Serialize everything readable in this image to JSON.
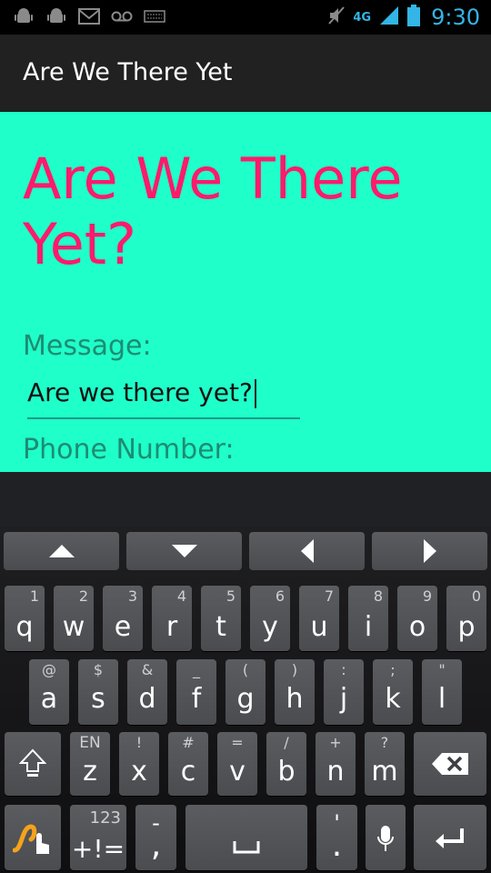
{
  "status_bar": {
    "time": "9:30",
    "network": "4G",
    "icons": [
      "android-debug-icon",
      "android-debug-icon",
      "gmail-icon",
      "voicemail-icon",
      "keyboard-icon",
      "mute-icon",
      "signal-icon",
      "battery-icon"
    ]
  },
  "action_bar": {
    "title": "Are We There Yet"
  },
  "main": {
    "heading": "Are We There Yet?",
    "message_label": "Message:",
    "message_value": "Are we there yet?",
    "phone_label": "Phone Number:"
  },
  "keyboard": {
    "row1": [
      {
        "key": "q",
        "hint": "1"
      },
      {
        "key": "w",
        "hint": "2"
      },
      {
        "key": "e",
        "hint": "3"
      },
      {
        "key": "r",
        "hint": "4"
      },
      {
        "key": "t",
        "hint": "5"
      },
      {
        "key": "y",
        "hint": "6"
      },
      {
        "key": "u",
        "hint": "7"
      },
      {
        "key": "i",
        "hint": "8"
      },
      {
        "key": "o",
        "hint": "9"
      },
      {
        "key": "p",
        "hint": "0"
      }
    ],
    "row2": [
      {
        "key": "a",
        "hint": "@"
      },
      {
        "key": "s",
        "hint": "$"
      },
      {
        "key": "d",
        "hint": "&"
      },
      {
        "key": "f",
        "hint": "_"
      },
      {
        "key": "g",
        "hint": "("
      },
      {
        "key": "h",
        "hint": ")"
      },
      {
        "key": "j",
        "hint": ":"
      },
      {
        "key": "k",
        "hint": ";"
      },
      {
        "key": "l",
        "hint": "\""
      }
    ],
    "row3": [
      {
        "key": "z",
        "hint": "EN"
      },
      {
        "key": "x",
        "hint": "!"
      },
      {
        "key": "c",
        "hint": "#"
      },
      {
        "key": "v",
        "hint": "="
      },
      {
        "key": "b",
        "hint": "/"
      },
      {
        "key": "n",
        "hint": "+"
      },
      {
        "key": "m",
        "hint": "?"
      }
    ],
    "row4": {
      "symbols_main": "+!=",
      "symbols_hint": "123",
      "comma_main": ",",
      "comma_hint": "-",
      "period_main": ".",
      "period_hint": "'"
    }
  },
  "colors": {
    "content_bg": "#1fffc9",
    "heading": "#ff1a6b",
    "label": "#1d8c73",
    "status_accent": "#33b5e5"
  }
}
